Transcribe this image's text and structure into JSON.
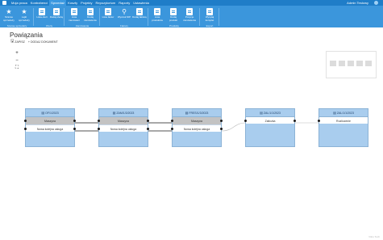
{
  "topnav": {
    "menu": [
      "Moja praca",
      "Kontrahenci",
      "Sprzedaż",
      "Koszty",
      "Projekty",
      "Repozytorium",
      "Raporty",
      "Ustawienia"
    ],
    "active_index": 2,
    "user": "Admin Testowy"
  },
  "ribbon": {
    "groups": [
      {
        "label": "Szanse sprzedaży",
        "buttons": [
          "Szanse sprzedaży",
          "Lejki sprzedaży"
        ]
      },
      {
        "label": "Oferty",
        "buttons": [
          "Lista ofert",
          "Dodaj ofertę"
        ]
      },
      {
        "label": "Zamówienia",
        "buttons": [
          "Lista zamówień",
          "Dodaj zamówienie"
        ]
      },
      {
        "label": "Faktury",
        "buttons": [
          "Lista faktur",
          "Wyszuk NIP",
          "Dodaj fakturę"
        ]
      },
      {
        "label": "Produkty",
        "buttons": [
          "Lista produktów",
          "Dodaj produkt",
          "Pozycje zamówienia"
        ]
      },
      {
        "label": "Export",
        "buttons": [
          "Wysyłaj komplet"
        ]
      }
    ]
  },
  "page": {
    "title": "Powiązania",
    "save_label": "ZAPISZ",
    "add_label": "+ DODAJ DOKUMENT"
  },
  "zoom": {
    "in": "+",
    "out": "−",
    "fit": "⛶"
  },
  "nodes": [
    {
      "header": "OF/1/2023",
      "rows": [
        "Maszyna",
        "Nowa kolejna usługa"
      ]
    },
    {
      "header": "ZAM/1/3/2023",
      "rows": [
        "Maszyna",
        "Nowa kolejna usługa"
      ]
    },
    {
      "header": "FRES/1/3/2023",
      "rows": [
        "Maszyna",
        "Nowa kolejna usługa"
      ]
    },
    {
      "header": "ZAL/1/1/2023",
      "rows": [
        "Zaliczka"
      ]
    },
    {
      "header": "ZAL/1/1/2023",
      "rows": [
        "Rozliczenie"
      ]
    }
  ],
  "watermark": "Vikro Tech"
}
